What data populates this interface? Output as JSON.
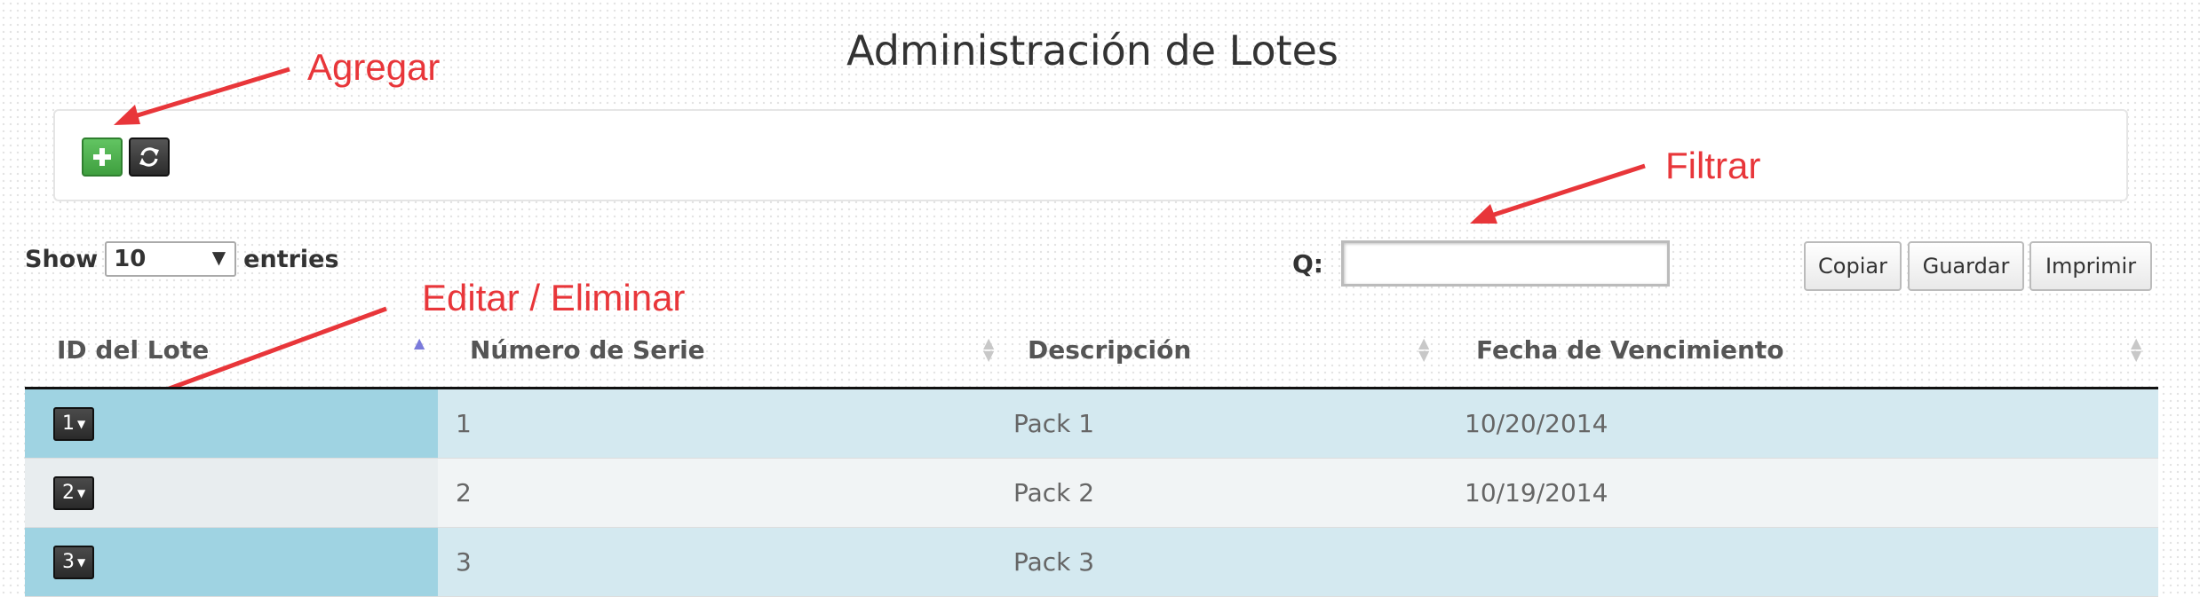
{
  "page": {
    "title": "Administración de Lotes"
  },
  "toolbar": {
    "add_icon": "plus-icon",
    "refresh_icon": "refresh-icon",
    "colors": {
      "add": "#4cae4c",
      "refresh": "#333333"
    }
  },
  "annotations": {
    "add": "Agregar",
    "filter": "Filtrar",
    "edit": "Editar / Eliminar",
    "color": "#e8363a"
  },
  "length": {
    "show": "Show",
    "value": "10",
    "entries": "entries"
  },
  "search": {
    "label": "Q:",
    "value": ""
  },
  "export": {
    "copy": "Copiar",
    "save": "Guardar",
    "print": "Imprimir"
  },
  "table": {
    "columns": [
      "ID del Lote",
      "Número de Serie",
      "Descripción",
      "Fecha de Vencimiento"
    ],
    "sorted_column": "ID del Lote",
    "rows": [
      {
        "id": "1",
        "serie": "1",
        "descripcion": "Pack 1",
        "fecha": "10/20/2014"
      },
      {
        "id": "2",
        "serie": "2",
        "descripcion": "Pack 2",
        "fecha": "10/19/2014"
      },
      {
        "id": "3",
        "serie": "3",
        "descripcion": "Pack 3",
        "fecha": ""
      }
    ]
  }
}
